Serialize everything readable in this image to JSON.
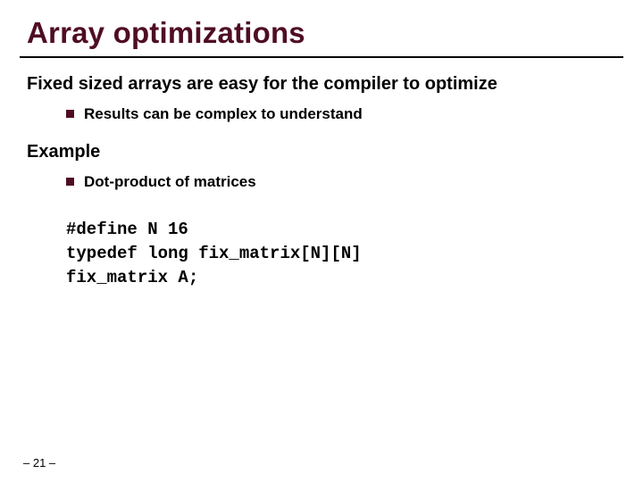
{
  "title": "Array optimizations",
  "section1": {
    "heading": "Fixed sized arrays are easy for the compiler to optimize",
    "bullet": "Results can be complex to understand"
  },
  "section2": {
    "heading": "Example",
    "bullet": "Dot-product of matrices"
  },
  "code": {
    "line1": "#define N 16",
    "line2": "typedef long fix_matrix[N][N]",
    "line3": "fix_matrix A;"
  },
  "footer": "– 21 –"
}
